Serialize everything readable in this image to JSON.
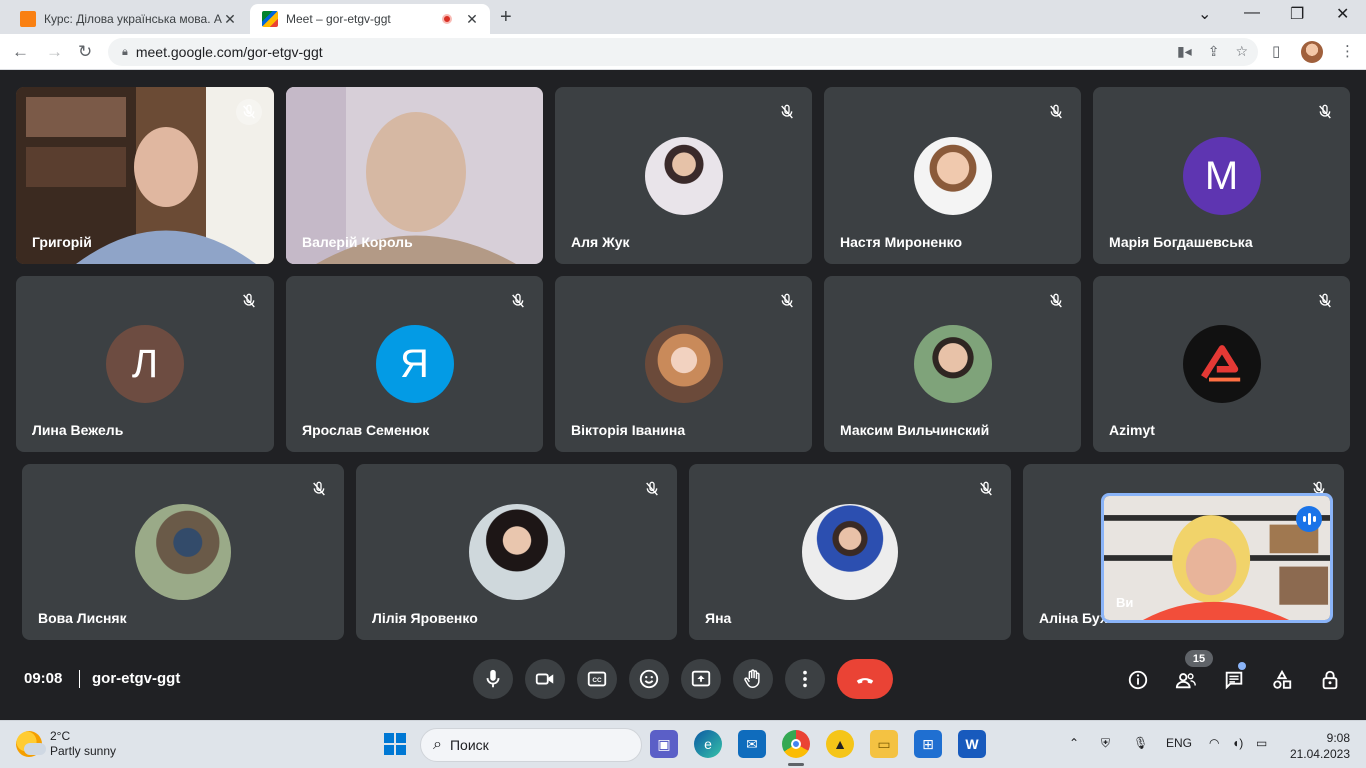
{
  "browser": {
    "tabs": [
      {
        "title": "Курс: Ділова українська мова. А",
        "active": false
      },
      {
        "title": "Meet – gor-etgv-ggt",
        "active": true
      }
    ],
    "url": "meet.google.com/gor-etgv-ggt"
  },
  "meeting": {
    "time": "09:08",
    "code": "gor-etgv-ggt",
    "participants_count": "15",
    "self_label": "Ви",
    "tiles": [
      {
        "name": "Григорій",
        "kind": "video"
      },
      {
        "name": "Валерій Король",
        "kind": "video"
      },
      {
        "name": "Аля Жук",
        "kind": "photo"
      },
      {
        "name": "Настя Мироненко",
        "kind": "photo"
      },
      {
        "name": "Марія Богдашевська",
        "kind": "letter",
        "letter": "М",
        "color": "#5e35b1"
      },
      {
        "name": "Лина Вежель",
        "kind": "letter",
        "letter": "Л",
        "color": "#6d4c41"
      },
      {
        "name": "Ярослав Семенюк",
        "kind": "letter",
        "letter": "Я",
        "color": "#039be5"
      },
      {
        "name": "Вікторія Іванина",
        "kind": "photo"
      },
      {
        "name": "Максим Вильчинский",
        "kind": "photo"
      },
      {
        "name": "Azimyt",
        "kind": "logo"
      },
      {
        "name": "Вова Лисняк",
        "kind": "photo"
      },
      {
        "name": "Лілія Яровенко",
        "kind": "photo"
      },
      {
        "name": "Яна",
        "kind": "photo"
      },
      {
        "name": "Аліна Бух",
        "kind": "hidden"
      }
    ]
  },
  "taskbar": {
    "weather_temp": "2°C",
    "weather_desc": "Partly sunny",
    "search_placeholder": "Поиск",
    "lang": "ENG",
    "time": "9:08",
    "date": "21.04.2023"
  }
}
